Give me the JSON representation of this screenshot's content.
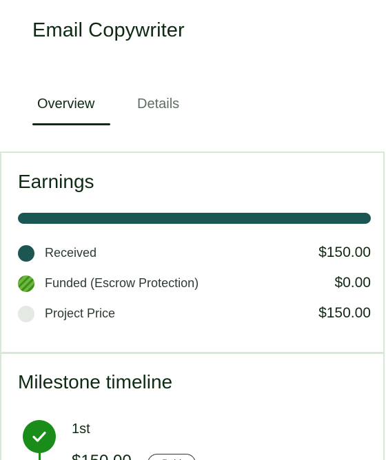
{
  "header": {
    "title": "Email Copywriter"
  },
  "tabs": [
    {
      "label": "Overview",
      "active": true
    },
    {
      "label": "Details",
      "active": false
    }
  ],
  "earnings": {
    "title": "Earnings",
    "progress_received_fraction": 1.0,
    "legend": [
      {
        "label": "Received",
        "value": "$150.00",
        "color": "#1b5653"
      },
      {
        "label": "Funded (Escrow Protection)",
        "value": "$0.00",
        "color": "#6bb83a"
      },
      {
        "label": "Project Price",
        "value": "$150.00",
        "color": "#e4e9e4"
      }
    ]
  },
  "milestones": {
    "title": "Milestone timeline",
    "items": [
      {
        "name": "1st",
        "amount": "$150.00",
        "status": "Paid",
        "icon": "check-icon"
      }
    ]
  },
  "colors": {
    "accent": "#1b5653",
    "success": "#1a8c1a",
    "divider": "#d9e7d9"
  }
}
